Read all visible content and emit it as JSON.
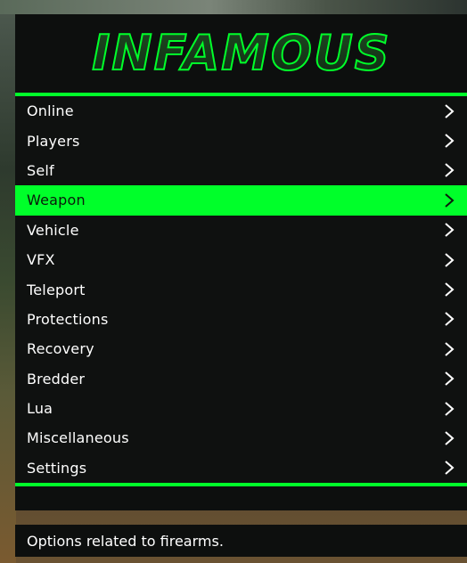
{
  "header": {
    "logo_text": "INFAMOUS"
  },
  "colors": {
    "accent": "#00ff2a",
    "panel": "#0f1110"
  },
  "menu": {
    "items": [
      {
        "label": "Online"
      },
      {
        "label": "Players"
      },
      {
        "label": "Self"
      },
      {
        "label": "Weapon",
        "selected": true
      },
      {
        "label": "Vehicle"
      },
      {
        "label": "VFX"
      },
      {
        "label": "Teleport"
      },
      {
        "label": "Protections"
      },
      {
        "label": "Recovery"
      },
      {
        "label": "Bredder"
      },
      {
        "label": "Lua"
      },
      {
        "label": "Miscellaneous"
      },
      {
        "label": "Settings"
      }
    ],
    "chevron_icon": "chevron-right-icon"
  },
  "footer": {
    "description": "Options related to firearms."
  }
}
